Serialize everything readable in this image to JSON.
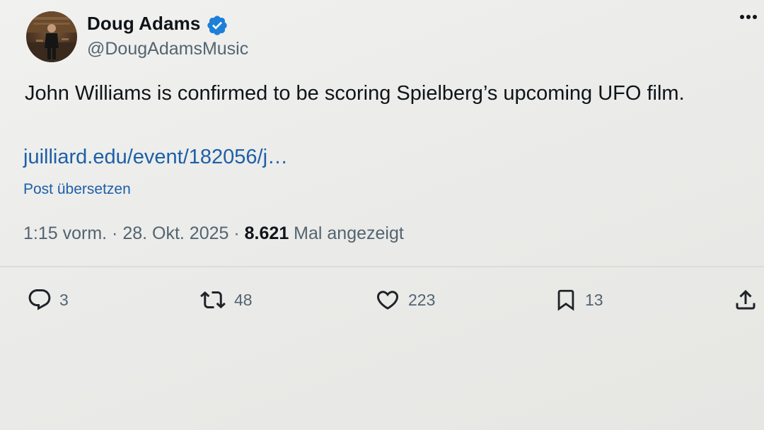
{
  "author": {
    "display_name": "Doug Adams",
    "handle": "@DougAdamsMusic",
    "verified": true
  },
  "post": {
    "text": "John Williams is confirmed to be scoring Spielberg’s upcoming UFO film.",
    "link_text": "juilliard.edu/event/182056/j…",
    "translate_label": "Post übersetzen"
  },
  "meta": {
    "time": "1:15 vorm.",
    "separator": " · ",
    "date": "28. Okt. 2025",
    "views_count": "8.621",
    "views_label": " Mal angezeigt"
  },
  "actions": {
    "replies": "3",
    "reposts": "48",
    "likes": "223",
    "bookmarks": "13"
  },
  "colors": {
    "link": "#1d5fa8",
    "verified_badge": "#1d7fd8",
    "text": "#0f1419",
    "secondary": "#536471"
  },
  "icons": {
    "more": "more-horizontal-icon",
    "reply": "reply-icon",
    "repost": "repost-icon",
    "like": "heart-icon",
    "bookmark": "bookmark-icon",
    "share": "share-icon",
    "verified": "verified-badge-icon"
  }
}
